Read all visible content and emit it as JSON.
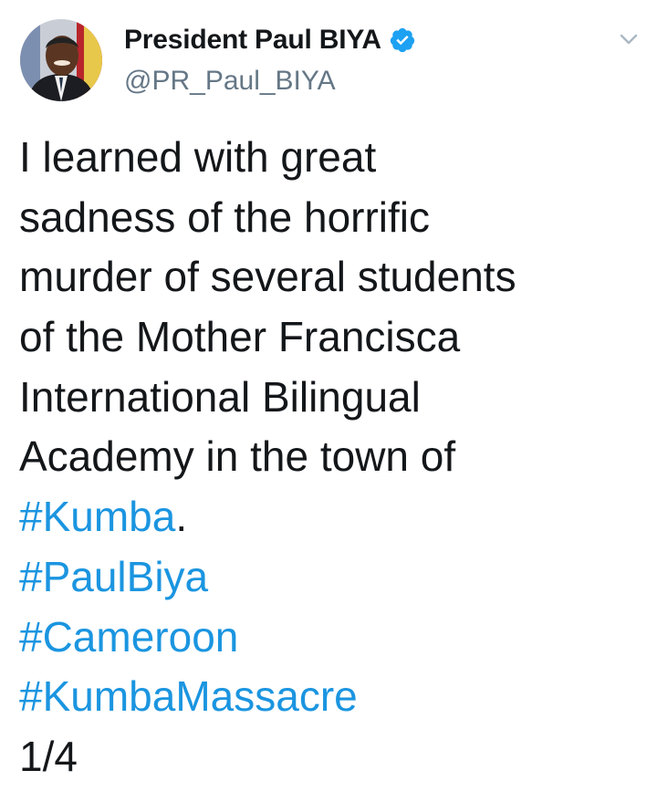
{
  "tweet": {
    "author": {
      "display_name": "President Paul BIYA",
      "handle": "@PR_Paul_BIYA",
      "verified": true,
      "verified_icon": "verified-badge-icon",
      "avatar_icon": "profile-photo"
    },
    "menu_icon": "chevron-down-icon",
    "text_lines": [
      "I learned with great",
      "sadness of the horrific",
      "murder of several students",
      "of the Mother Francisca",
      "International Bilingual",
      "Academy in the town of"
    ],
    "hashtag_line_1": {
      "tag": "#Kumba",
      "suffix": "."
    },
    "hashtags": [
      "#PaulBiya",
      "#Cameroon",
      "#KumbaMassacre"
    ],
    "thread_index": "1/4"
  },
  "colors": {
    "text": "#14171a",
    "secondary_text": "#657786",
    "hashtag": "#1b95e0",
    "verified_badge": "#1da1f2",
    "background": "#ffffff"
  }
}
